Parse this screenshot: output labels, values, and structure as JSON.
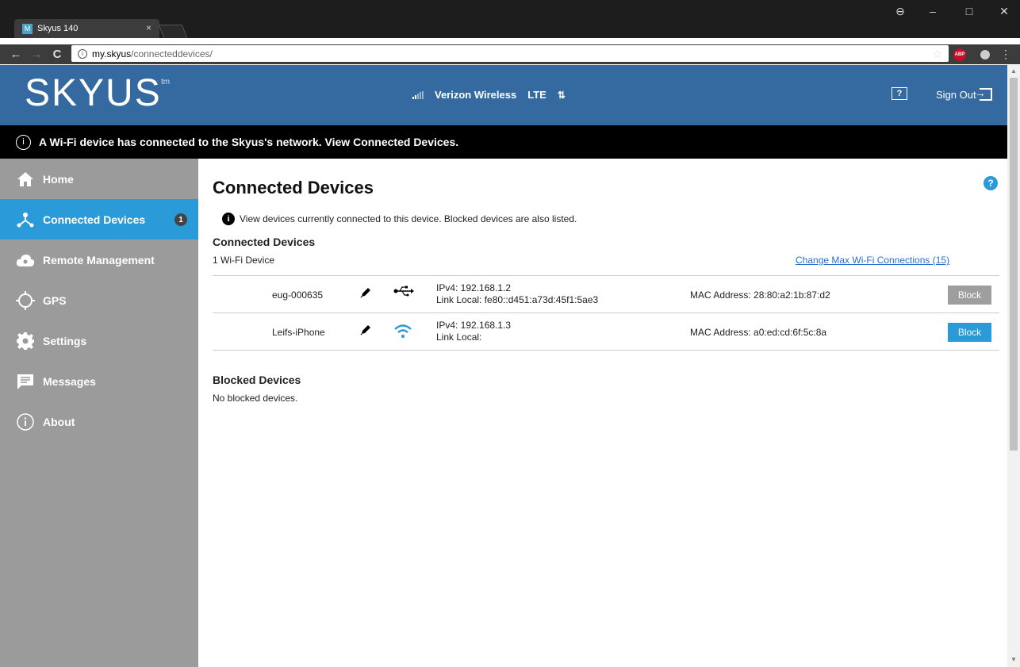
{
  "browser": {
    "tab_title": "Skyus 140",
    "tab_favicon": "M",
    "tab_close": "×",
    "url_host": "my.skyus",
    "url_path": "/connecteddevices/",
    "controls": {
      "back": "←",
      "forward": "→",
      "reload": "C",
      "minimize": "–",
      "maximize": "□",
      "close": "✕",
      "profile": "⊖",
      "star": "☆",
      "abp": "ABP",
      "menu": "⋮"
    }
  },
  "header": {
    "logo": "SKYUS",
    "logo_tm": "tm",
    "carrier": "Verizon Wireless",
    "network": "LTE",
    "help": "?",
    "signout": "Sign Out"
  },
  "banner": {
    "text": "A Wi-Fi device has connected to the Skyus's network. View Connected Devices."
  },
  "sidebar": {
    "items": [
      {
        "label": "Home"
      },
      {
        "label": "Connected Devices",
        "badge": "1"
      },
      {
        "label": "Remote Management"
      },
      {
        "label": "GPS"
      },
      {
        "label": "Settings"
      },
      {
        "label": "Messages"
      },
      {
        "label": "About"
      }
    ]
  },
  "main": {
    "title": "Connected Devices",
    "help": "?",
    "info": "View devices currently connected to this device. Blocked devices are also listed.",
    "connected_heading": "Connected Devices",
    "device_count": "1 Wi-Fi Device",
    "max_link": "Change Max Wi-Fi Connections (15)",
    "devices": [
      {
        "name": "eug-000635",
        "connection": "usb-icon",
        "ipv4": "IPv4: 192.168.1.2",
        "link_local": "Link Local: fe80::d451:a73d:45f1:5ae3",
        "mac": "MAC Address: 28:80:a2:1b:87:d2",
        "block_label": "Block",
        "block_enabled": false
      },
      {
        "name": "Leifs-iPhone",
        "connection": "wifi-icon",
        "ipv4": "IPv4: 192.168.1.3",
        "link_local": "Link Local:",
        "mac": "MAC Address: a0:ed:cd:6f:5c:8a",
        "block_label": "Block",
        "block_enabled": true
      }
    ],
    "blocked_heading": "Blocked Devices",
    "no_blocked": "No blocked devices."
  },
  "colors": {
    "header_bg": "#356aa0",
    "sidebar_bg": "#9b9b9b",
    "active_nav": "#2a9ad8",
    "link": "#2a6fcf"
  }
}
